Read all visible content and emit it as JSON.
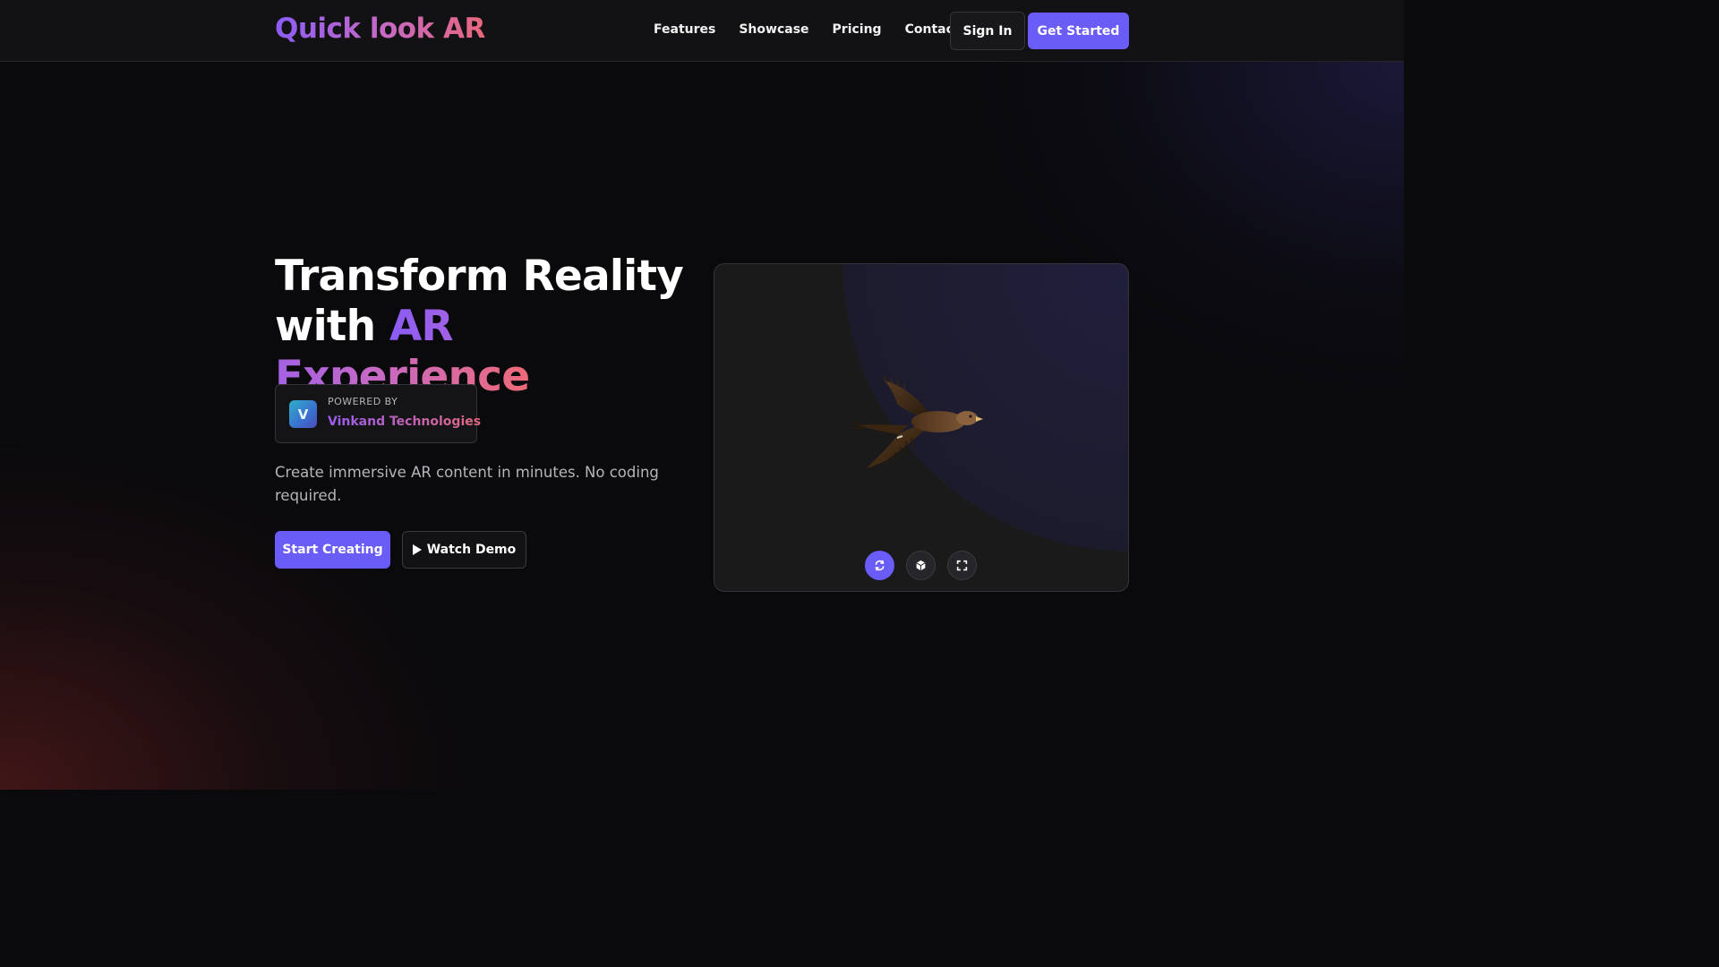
{
  "header": {
    "logo": "Quick look AR",
    "nav": [
      "Features",
      "Showcase",
      "Pricing",
      "Contact"
    ],
    "signin_label": "Sign In",
    "getstarted_label": "Get Started"
  },
  "hero": {
    "title_line1": "Transform Reality",
    "title_with": "with",
    "title_highlight": "AR Experience",
    "powered_label": "POWERED BY",
    "powered_name": "Vinkand Technologies",
    "powered_logo_text": "V",
    "subtitle": "Create immersive AR content in minutes. No coding required.",
    "start_label": "Start Creating",
    "demo_label": "Watch Demo"
  },
  "viewer": {
    "model": "eagle",
    "controls": [
      "rotate-icon",
      "cube-icon",
      "fullscreen-icon"
    ]
  },
  "colors": {
    "accent": "#6a5cf6",
    "gradient_start": "#8b5cf6",
    "gradient_end": "#e8677c",
    "background": "#0a0a0c"
  }
}
